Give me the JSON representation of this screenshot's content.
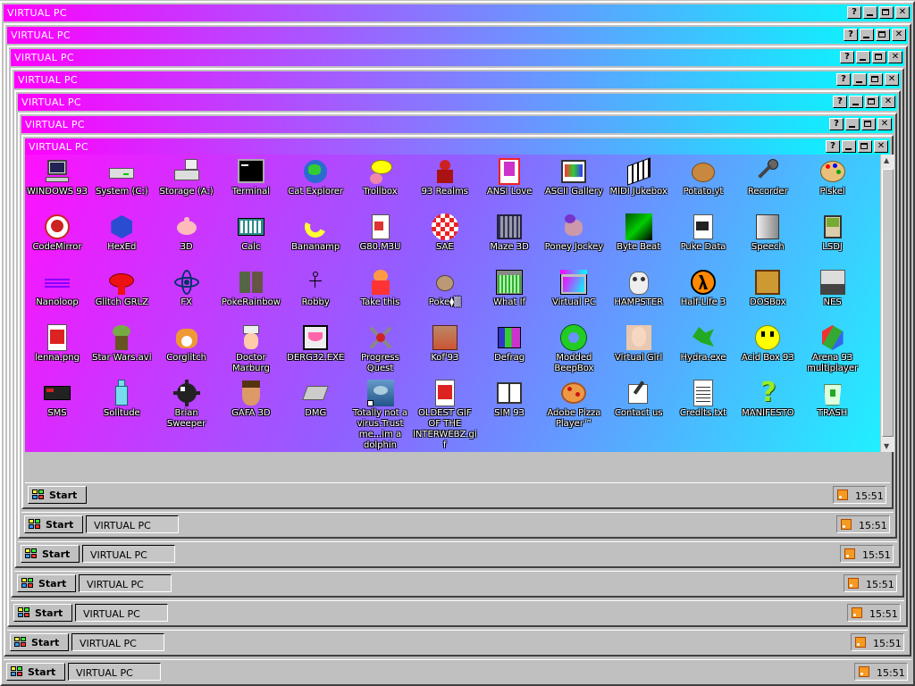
{
  "window_title": "VIRTUAL PC",
  "start_label": "Start",
  "task_label": "VIRTUAL PC",
  "clock": "15:51",
  "help_glyph": "?",
  "icons": [
    {
      "label": "WINDOWS 93",
      "icon": "computer-icon"
    },
    {
      "label": "System (C:)",
      "icon": "drive-icon"
    },
    {
      "label": "Storage (A:)",
      "icon": "floppy-drive-icon"
    },
    {
      "label": "Terminal",
      "icon": "terminal-icon"
    },
    {
      "label": "Cat Explorer",
      "icon": "cat-globe-icon"
    },
    {
      "label": "Trollbox",
      "icon": "chat-bubble-icon"
    },
    {
      "label": "93 Realms",
      "icon": "warrior-icon"
    },
    {
      "label": "ANSI Love",
      "icon": "ansi-book-icon"
    },
    {
      "label": "ASCII Gallery",
      "icon": "ascii-gallery-icon"
    },
    {
      "label": "MIDI Jukebox",
      "icon": "midi-keys-icon"
    },
    {
      "label": "Potato.yt",
      "icon": "potato-icon"
    },
    {
      "label": "Recorder",
      "icon": "microphone-icon"
    },
    {
      "label": "Piskel",
      "icon": "palette-icon"
    },
    {
      "label": "CodeMirror",
      "icon": "codemirror-icon"
    },
    {
      "label": "HexEd",
      "icon": "hex-cube-icon"
    },
    {
      "label": "3D",
      "icon": "teapot-icon"
    },
    {
      "label": "Calc",
      "icon": "calculator-icon"
    },
    {
      "label": "Bananamp",
      "icon": "banana-icon"
    },
    {
      "label": "G80.M3U",
      "icon": "speaker-file-icon"
    },
    {
      "label": "SAE",
      "icon": "amiga-ball-icon"
    },
    {
      "label": "Maze 3D",
      "icon": "maze-icon"
    },
    {
      "label": "Poney Jockey",
      "icon": "pony-icon"
    },
    {
      "label": "Byte Beat",
      "icon": "bytebeat-icon"
    },
    {
      "label": "Puke Data",
      "icon": "puke-data-icon"
    },
    {
      "label": "Speech",
      "icon": "speech-face-icon"
    },
    {
      "label": "LSDJ",
      "icon": "gameboy-music-icon"
    },
    {
      "label": "Nanoloop",
      "icon": "nanoloop-icon"
    },
    {
      "label": "Glitch GRLZ",
      "icon": "lips-icon"
    },
    {
      "label": "FX",
      "icon": "atom-icon"
    },
    {
      "label": "PokeRainbow",
      "icon": "pokerainbow-icon"
    },
    {
      "label": "Robby",
      "icon": "stick-figure-icon"
    },
    {
      "label": "Take this",
      "icon": "old-man-icon"
    },
    {
      "label": "Poke⧫▒",
      "icon": "poke-ball-icon"
    },
    {
      "label": "What If",
      "icon": "whatif-window-icon"
    },
    {
      "label": "Virtual PC",
      "icon": "virtual-pc-icon"
    },
    {
      "label": "HAMPSTER",
      "icon": "owl-icon"
    },
    {
      "label": "Half-Life 3",
      "icon": "half-life-icon"
    },
    {
      "label": "DOSBox",
      "icon": "dosbox-icon"
    },
    {
      "label": "NES",
      "icon": "nes-icon"
    },
    {
      "label": "lenna.png",
      "icon": "image-file-icon"
    },
    {
      "label": "Star Wars.avi",
      "icon": "yoda-icon"
    },
    {
      "label": "Corglitch",
      "icon": "corgi-icon"
    },
    {
      "label": "Doctor Marburg",
      "icon": "doctor-icon"
    },
    {
      "label": "DERG32.EXE",
      "icon": "derg-icon"
    },
    {
      "label": "Progress Quest",
      "icon": "crossed-swords-icon"
    },
    {
      "label": "Kof'93",
      "icon": "fighter-icon"
    },
    {
      "label": "Defrag",
      "icon": "defrag-icon"
    },
    {
      "label": "Modded BeepBox",
      "icon": "ring-icon"
    },
    {
      "label": "Virtual Girl",
      "icon": "virtual-girl-icon"
    },
    {
      "label": "Hydra.exe",
      "icon": "hydra-icon"
    },
    {
      "label": "Acid Box 93",
      "icon": "smiley-icon"
    },
    {
      "label": "Arena 93 multiplayer",
      "icon": "cube-icon"
    },
    {
      "label": "SMS",
      "icon": "sms-console-icon"
    },
    {
      "label": "Solitude",
      "icon": "bottle-icon"
    },
    {
      "label": "Brian Sweeper",
      "icon": "mine-icon"
    },
    {
      "label": "GAFA 3D",
      "icon": "gafa-face-icon"
    },
    {
      "label": "DMG",
      "icon": "cartridge-icon"
    },
    {
      "label": "Totally not a virus.Trust me...im a dolphin",
      "icon": "dolphin-icon"
    },
    {
      "label": "OLDEST GIF OF THE INTERWEBZ.gif",
      "icon": "gif-file-icon"
    },
    {
      "label": "SIM 93",
      "icon": "sim-book-icon"
    },
    {
      "label": "Adobe Pizza Player™",
      "icon": "pizza-icon"
    },
    {
      "label": "Contact us",
      "icon": "contact-icon"
    },
    {
      "label": "Credits.txt",
      "icon": "text-file-icon"
    },
    {
      "label": "MANIFESTO",
      "icon": "question-mark-icon"
    },
    {
      "label": "TRASH",
      "icon": "recycle-bin-icon"
    }
  ]
}
